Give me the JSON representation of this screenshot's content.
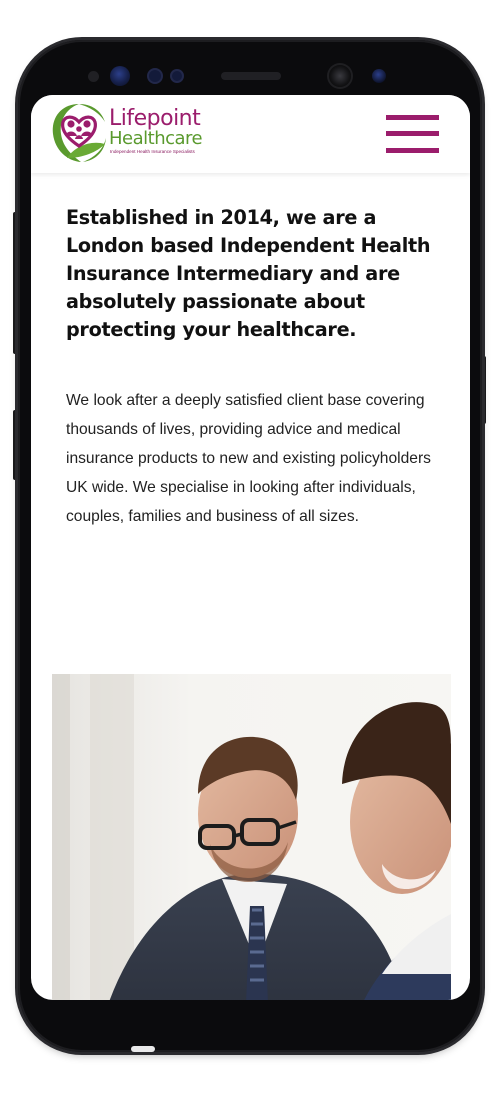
{
  "brand": {
    "name_line1": "Lifepoint",
    "name_line2": "Healthcare",
    "tagline": "Independent Health Insurance Specialists",
    "primary_color": "#9b1d6c",
    "secondary_color": "#5a9a2e"
  },
  "header": {
    "menu_icon": "hamburger-menu-icon"
  },
  "main": {
    "headline": "Established in 2014, we are a London based Independent Health Insurance Intermediary and are absolutely passionate about protecting your healthcare.",
    "body": "We look after a deeply satisfied client base covering thousands of lives, providing advice and medical insurance products to new and existing policyholders UK wide. We specialise in looking after individuals, couples, families and business of all sizes."
  }
}
